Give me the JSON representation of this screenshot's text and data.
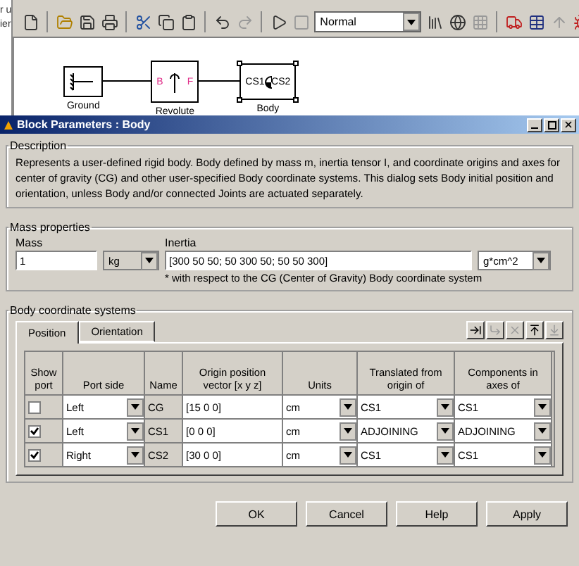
{
  "background": {
    "side_fragments": [
      "r u",
      "ier"
    ],
    "toolbar": {
      "sim_mode": "Normal"
    },
    "blocks": [
      {
        "label": "Ground",
        "kind": "ground",
        "selected": false
      },
      {
        "label": "Revolute",
        "kind": "joint",
        "ports": [
          "B",
          "F"
        ],
        "selected": false
      },
      {
        "label": "Body",
        "kind": "body",
        "ports": [
          "CS1",
          "CS2"
        ],
        "selected": true
      }
    ]
  },
  "dialog": {
    "title": "Block Parameters : Body",
    "description": {
      "heading": "Description",
      "text": "Represents a user-defined rigid body. Body defined by mass m, inertia tensor I, and coordinate origins and axes for center of gravity (CG) and other user-specified Body coordinate systems. This dialog sets Body initial position and orientation, unless Body and/or connected Joints are actuated separately."
    },
    "mass_properties": {
      "heading": "Mass properties",
      "mass_label": "Mass",
      "mass_value": "1",
      "mass_unit": "kg",
      "inertia_label": "Inertia",
      "inertia_value": "[300 50 50; 50 300 50; 50 50 300]",
      "inertia_unit": "g*cm^2",
      "note": "* with respect to the CG (Center of Gravity) Body coordinate system"
    },
    "coordinate_systems": {
      "heading": "Body coordinate systems",
      "tabs": [
        {
          "label": "Position",
          "selected": true
        },
        {
          "label": "Orientation",
          "selected": false
        }
      ],
      "columns": [
        "Show port",
        "Port side",
        "Name",
        "Origin position vector [x y z]",
        "Units",
        "Translated from origin of",
        "Components in axes of"
      ],
      "rows": [
        {
          "show_port": false,
          "port_side": "Left",
          "name": "CG",
          "origin": "[15 0 0]",
          "units": "cm",
          "translated_from": "CS1",
          "components_in": "CS1"
        },
        {
          "show_port": true,
          "port_side": "Left",
          "name": "CS1",
          "origin": "[0 0 0]",
          "units": "cm",
          "translated_from": "ADJOINING",
          "components_in": "ADJOINING"
        },
        {
          "show_port": true,
          "port_side": "Right",
          "name": "CS2",
          "origin": "[30 0 0]",
          "units": "cm",
          "translated_from": "CS1",
          "components_in": "CS1"
        }
      ]
    },
    "buttons": [
      "OK",
      "Cancel",
      "Help",
      "Apply"
    ]
  }
}
